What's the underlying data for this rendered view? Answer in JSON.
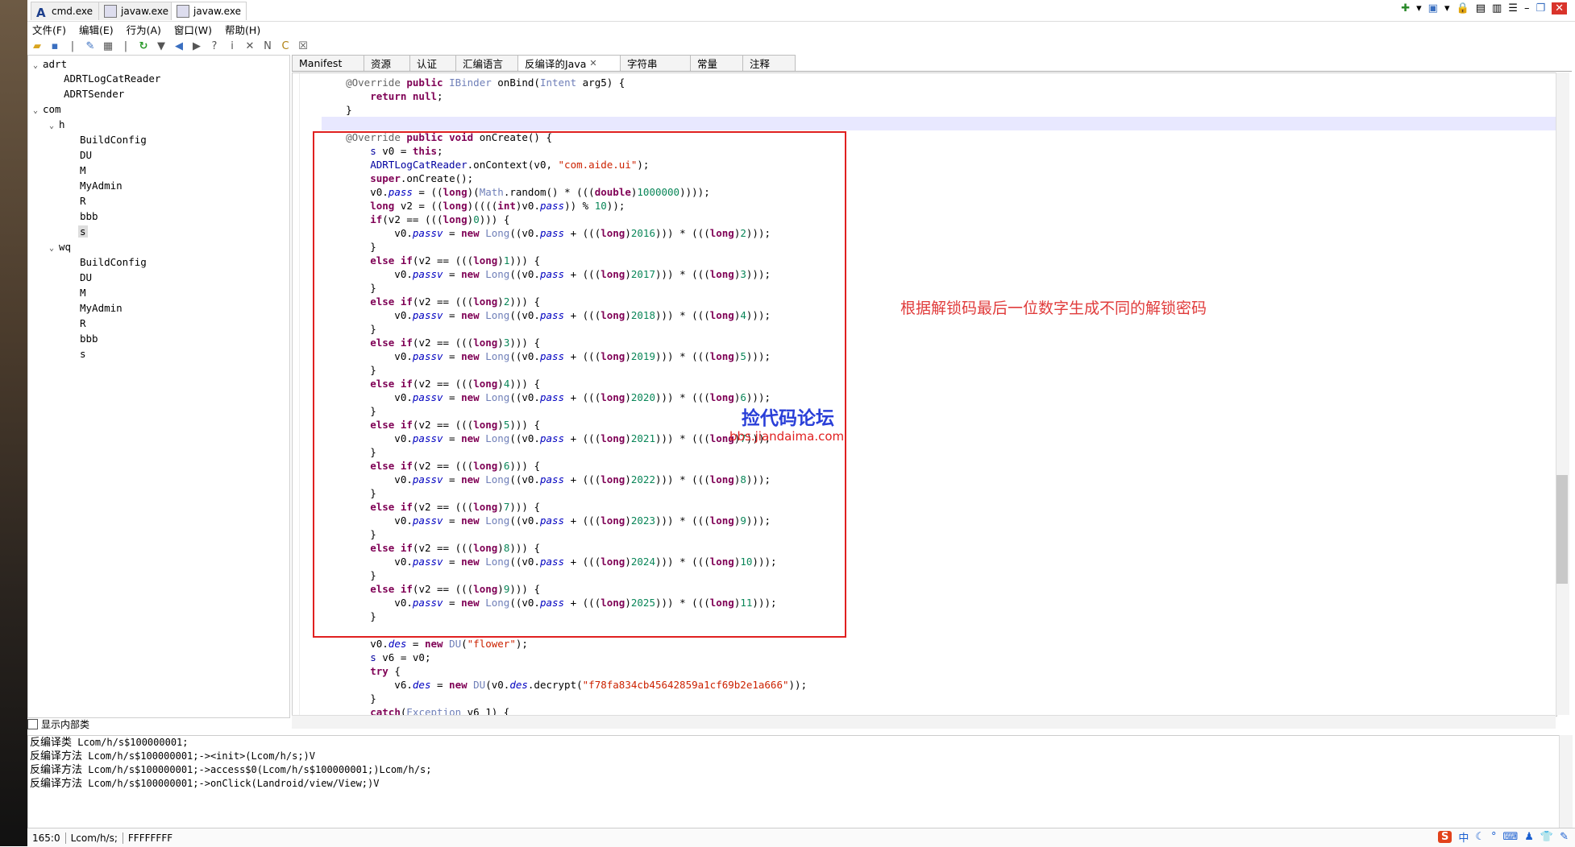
{
  "window_tabs": [
    {
      "label": "cmd.exe",
      "icon": "aide-a-icon",
      "active": false
    },
    {
      "label": "javaw.exe",
      "icon": "app-window-icon",
      "active": false
    },
    {
      "label": "javaw.exe",
      "icon": "app-window-icon",
      "active": true
    }
  ],
  "menu": [
    "文件(F)",
    "编辑(E)",
    "行为(A)",
    "窗口(W)",
    "帮助(H)"
  ],
  "tree": {
    "packages": [
      {
        "name": "adrt",
        "children": [
          "ADRTLogCatReader",
          "ADRTSender"
        ]
      },
      {
        "name": "com"
      },
      {
        "name": "h",
        "children": [
          "BuildConfig",
          "DU",
          "M",
          "MyAdmin",
          "R",
          "bbb",
          "s"
        ]
      },
      {
        "name": "wq",
        "children": [
          "BuildConfig",
          "DU",
          "M",
          "MyAdmin",
          "R",
          "bbb",
          "s"
        ]
      }
    ],
    "selected": "s",
    "show_inner_classes_label": "显示内部类"
  },
  "editor_tabs": [
    "Manifest",
    "资源",
    "认证",
    "汇编语言",
    "反编译的Java",
    "字符串",
    "常量",
    "注释"
  ],
  "active_editor_tab": "反编译的Java",
  "annotation_note": "根据解锁码最后一位数字生成不同的解锁密码",
  "watermark": {
    "title": "捡代码论坛",
    "url": "bbs.jiandaima.com"
  },
  "console_lines": [
    {
      "prefix": "反编译类",
      "text": " Lcom/h/s$100000001;"
    },
    {
      "prefix": "反编译方法",
      "text": " Lcom/h/s$100000001;-><init>(Lcom/h/s;)V"
    },
    {
      "prefix": "反编译方法",
      "text": " Lcom/h/s$100000001;->access$0(Lcom/h/s$100000001;)Lcom/h/s;"
    },
    {
      "prefix": "反编译方法",
      "text": " Lcom/h/s$100000001;->onClick(Landroid/view/View;)V"
    }
  ],
  "status": {
    "position": "165:0",
    "class": "Lcom/h/s;",
    "value": "FFFFFFFF"
  },
  "colors": {
    "highlight_box": "#e02020",
    "note_text": "#e03c3c",
    "watermark_title": "#2a3fd8"
  }
}
